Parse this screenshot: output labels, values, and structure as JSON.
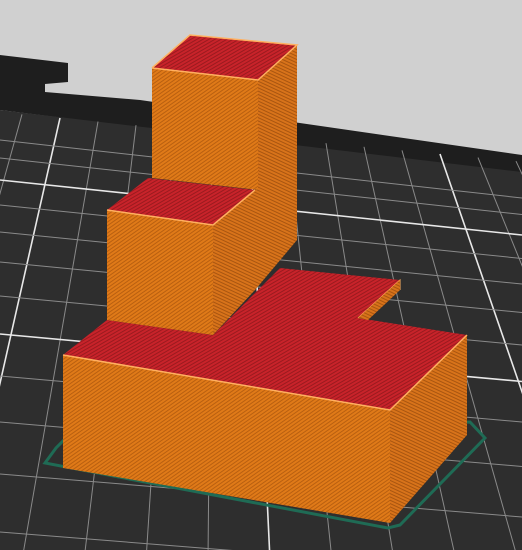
{
  "viewport": {
    "background_color": "#d0d0d0",
    "bed_color": "#2e2e2e",
    "bed_far_edge_color": "#1e1e1e",
    "grid_major_color": "#e8e8e8",
    "grid_minor_color": "#8a8a8a",
    "skirt_color": "#1f6b55",
    "perimeter_color": "#e07a18",
    "perimeter_dark_color": "#b85f10",
    "infill_color": "#c8232a",
    "infill_dark_color": "#961a1f",
    "highlight_color": "#ffd070"
  },
  "model": {
    "blocks": [
      "base",
      "middle-step",
      "tall-column"
    ],
    "view": "preview-sliced-layers"
  }
}
